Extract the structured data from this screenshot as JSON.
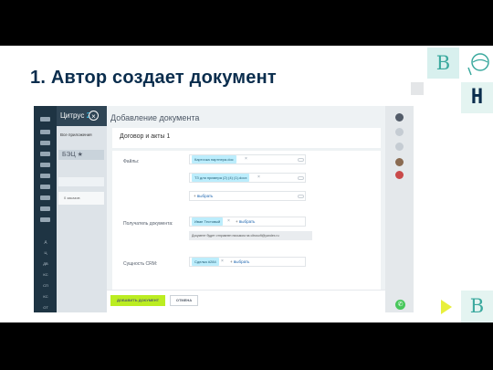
{
  "slide": {
    "title": "1. Автор создает документ",
    "logo_letter": "B",
    "logo_symbol": "H"
  },
  "bitrix": {
    "app_name_prefix": "Цитрус",
    "app_name_suffix": "24",
    "close_symbol": "×",
    "panel": {
      "apps_label": "Все приложения",
      "tab_label": "БЭЦ ★",
      "row_label": "0     заказов"
    },
    "sidebar_texts": [
      "Д",
      "Ц",
      "ДВ",
      "КС",
      "СП",
      "КС",
      "ОТ"
    ],
    "slider": {
      "title": "Добавление документа",
      "doc_name": "Договор и акты 1",
      "files_label": "Файлы:",
      "file1": "Карточка партнера.doc",
      "file2": "ТЗ для примера (2) (4) (1).docx",
      "choose": "выбрать",
      "recipient_label": "Получатель документа:",
      "recipient": "Иван Тестовый",
      "notice": "Документ будет отправлен письмом на citrusoft@yandex.ru",
      "crm_label": "Сущность CRM:",
      "crm_value": "Сделка #284"
    },
    "footer": {
      "add_button": "ДОБАВИТЬ ДОКУМЕНТ",
      "cancel_button": "ОТМЕНА"
    },
    "colors": {
      "accent_green": "#bbed21",
      "tag_blue": "#bcedfc",
      "sidebar_dark": "#1e3443"
    }
  }
}
